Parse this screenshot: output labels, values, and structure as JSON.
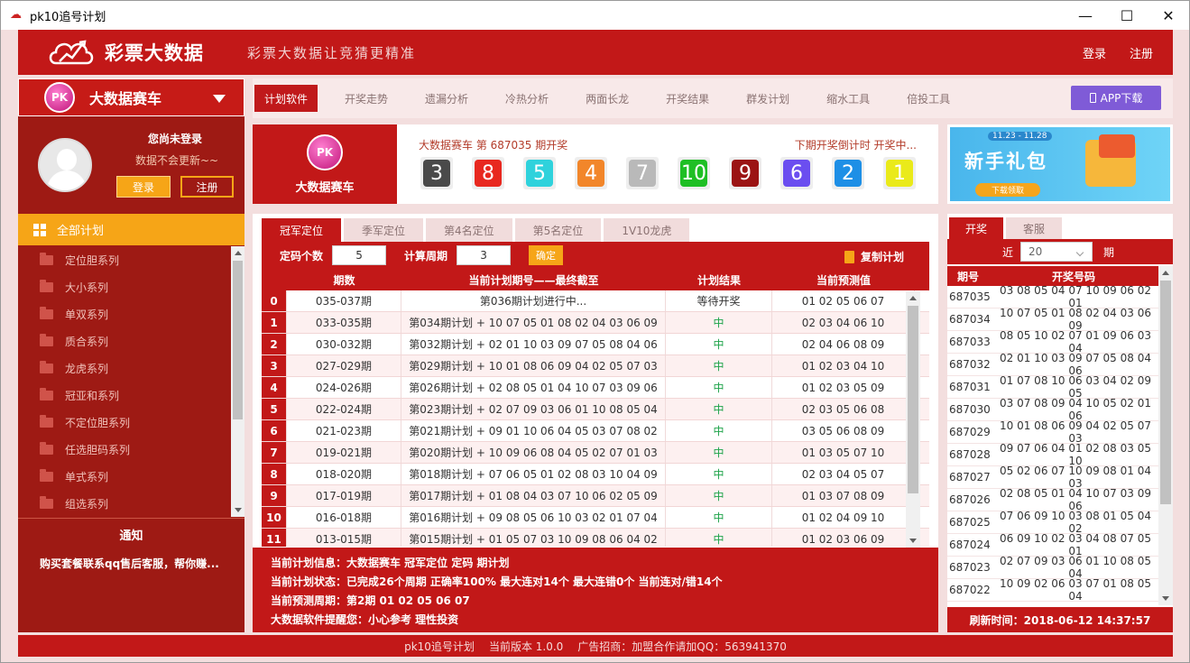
{
  "window": {
    "title": "pk10追号计划",
    "icon": "app-logo-icon",
    "controls": [
      "minimize-icon",
      "maximize-icon",
      "close-icon"
    ]
  },
  "header": {
    "brand": "彩票大数据",
    "slogan": "彩票大数据让竞猜更精准",
    "login": "登录",
    "register": "注册"
  },
  "game_select": {
    "badge": "PK",
    "label": "大数据赛车"
  },
  "user": {
    "status": "您尚未登录",
    "hint": "数据不会更新~~",
    "login_btn": "登录",
    "register_btn": "注册"
  },
  "all_plan": "全部计划",
  "menu": [
    "定位胆系列",
    "大小系列",
    "单双系列",
    "质合系列",
    "龙虎系列",
    "冠亚和系列",
    "不定位胆系列",
    "任选胆码系列",
    "单式系列",
    "组选系列"
  ],
  "notice": {
    "title": "通知",
    "content": "购买套餐联系qq售后客服，帮你赚..."
  },
  "nav": [
    "计划软件",
    "开奖走势",
    "遗漏分析",
    "冷热分析",
    "两面长龙",
    "开奖结果",
    "群发计划",
    "缩水工具",
    "倍投工具"
  ],
  "app_download": "APP下载",
  "game": {
    "name": "大数据赛车",
    "info": "大数据赛车 第 687035 期开奖",
    "countdown": "下期开奖倒计时 开奖中...",
    "balls": [
      {
        "n": "3",
        "color": "#4a4a4a"
      },
      {
        "n": "8",
        "color": "#e8281f"
      },
      {
        "n": "5",
        "color": "#2fd2dc"
      },
      {
        "n": "4",
        "color": "#f2862a"
      },
      {
        "n": "7",
        "color": "#b9b9b9"
      },
      {
        "n": "10",
        "color": "#1fbf25"
      },
      {
        "n": "9",
        "color": "#9b1414"
      },
      {
        "n": "6",
        "color": "#6b4ef0"
      },
      {
        "n": "2",
        "color": "#1e8fe6"
      },
      {
        "n": "1",
        "color": "#eaea1a"
      }
    ]
  },
  "ad": {
    "date": "11.23 - 11.28",
    "title": "新手礼包",
    "button": "下载领取"
  },
  "plan": {
    "tabs": [
      "冠军定位",
      "季军定位",
      "第4名定位",
      "第5名定位",
      "1V10龙虎"
    ],
    "count_label": "定码个数",
    "count_value": "5",
    "period_label": "计算周期",
    "period_value": "3",
    "confirm": "确定",
    "copy": "复制计划",
    "columns": [
      "期数",
      "当前计划期号——最终截至",
      "计划结果",
      "当前预测值"
    ],
    "rows": [
      [
        "0",
        "035-037期",
        "第036期计划进行中...",
        "等待开奖",
        "01 02 05 06 07"
      ],
      [
        "1",
        "033-035期",
        "第034期计划 + 10 07 05 01 08 02 04 03 06 09",
        "中",
        "02 03 04 06 10"
      ],
      [
        "2",
        "030-032期",
        "第032期计划 + 02 01 10 03 09 07 05 08 04 06",
        "中",
        "02 04 06 08 09"
      ],
      [
        "3",
        "027-029期",
        "第029期计划 + 10 01 08 06 09 04 02 05 07 03",
        "中",
        "01 02 03 04 10"
      ],
      [
        "4",
        "024-026期",
        "第026期计划 + 02 08 05 01 04 10 07 03 09 06",
        "中",
        "01 02 03 05 09"
      ],
      [
        "5",
        "022-024期",
        "第023期计划 + 02 07 09 03 06 01 10 08 05 04",
        "中",
        "02 03 05 06 08"
      ],
      [
        "6",
        "021-023期",
        "第021期计划 + 09 01 10 06 04 05 03 07 08 02",
        "中",
        "03 05 06 08 09"
      ],
      [
        "7",
        "019-021期",
        "第020期计划 + 10 09 06 08 04 05 02 07 01 03",
        "中",
        "01 03 05 07 10"
      ],
      [
        "8",
        "018-020期",
        "第018期计划 + 07 06 05 01 02 08 03 10 04 09",
        "中",
        "02 03 04 05 07"
      ],
      [
        "9",
        "017-019期",
        "第017期计划 + 01 08 04 03 07 10 06 02 05 09",
        "中",
        "01 03 07 08 09"
      ],
      [
        "10",
        "016-018期",
        "第016期计划 + 09 08 05 06 10 03 02 01 07 04",
        "中",
        "01 02 04 09 10"
      ],
      [
        "11",
        "013-015期",
        "第015期计划 + 01 05 07 03 10 09 08 06 04 02",
        "中",
        "01 02 03 06 09"
      ]
    ],
    "info": [
      "当前计划信息：大数据赛车 冠军定位 定码 期计划",
      "当前计划状态：已完成26个周期 正确率100% 最大连对14个 最大连错0个 当前连对/错14个",
      "当前预测周期：第2期 01 02 05 06 07",
      "大数据软件提醒您：小心参考 理性投资"
    ]
  },
  "draw": {
    "tabs": [
      "开奖",
      "客服"
    ],
    "near": "近",
    "near_value": "20",
    "period": "期",
    "col_issue": "期号",
    "col_numbers": "开奖号码",
    "rows": [
      [
        "687035",
        "03 08 05 04 07 10 09 06 02 01"
      ],
      [
        "687034",
        "10 07 05 01 08 02 04 03 06 09"
      ],
      [
        "687033",
        "08 05 10 02 07 01 09 06 03 04"
      ],
      [
        "687032",
        "02 01 10 03 09 07 05 08 04 06"
      ],
      [
        "687031",
        "01 07 08 10 06 03 04 02 09 05"
      ],
      [
        "687030",
        "03 07 08 09 04 10 05 02 01 06"
      ],
      [
        "687029",
        "10 01 08 06 09 04 02 05 07 03"
      ],
      [
        "687028",
        "09 07 06 04 01 02 08 03 05 10"
      ],
      [
        "687027",
        "05 02 06 07 10 09 08 01 04 03"
      ],
      [
        "687026",
        "02 08 05 01 04 10 07 03 09 06"
      ],
      [
        "687025",
        "07 06 09 10 03 08 01 05 04 02"
      ],
      [
        "687024",
        "06 09 10 02 03 04 08 07 05 01"
      ],
      [
        "687023",
        "02 07 09 03 06 01 10 08 05 04"
      ],
      [
        "687022",
        "10 09 02 06 03 07 01 08 05 04"
      ]
    ],
    "refresh": "刷新时间：2018-06-12 14:37:57"
  },
  "footer": {
    "app": "pk10追号计划",
    "version": "当前版本 1.0.0",
    "ad": "广告招商：加盟合作请加QQ：563941370"
  }
}
